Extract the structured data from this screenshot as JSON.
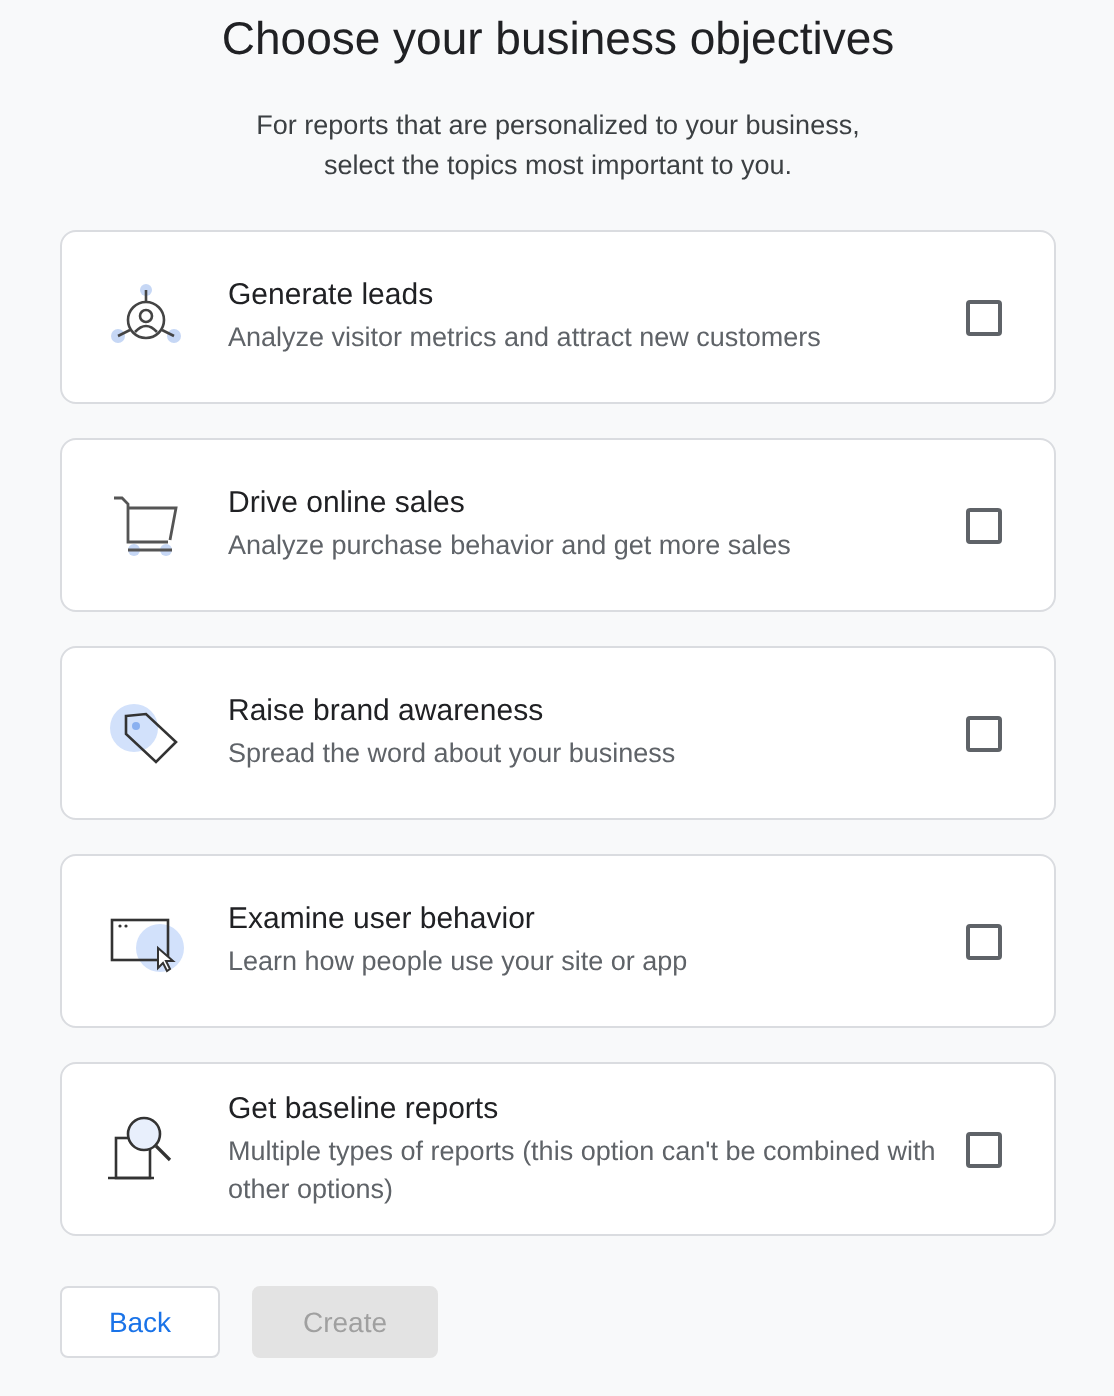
{
  "title": "Choose your business objectives",
  "subtitle_lines": [
    "For reports that are personalized to your business,",
    "select the topics most important to you."
  ],
  "objectives": [
    {
      "kind": "leads",
      "title": "Generate leads",
      "description": "Analyze visitor metrics and attract new customers",
      "checked": false
    },
    {
      "kind": "sales",
      "title": "Drive online sales",
      "description": "Analyze purchase behavior and get more sales",
      "checked": false
    },
    {
      "kind": "brand",
      "title": "Raise brand awareness",
      "description": "Spread the word about your business",
      "checked": false
    },
    {
      "kind": "behavior",
      "title": "Examine user behavior",
      "description": "Learn how people use your site or app",
      "checked": false
    },
    {
      "kind": "baseline",
      "title": "Get baseline reports",
      "description": "Multiple types of reports (this option can't be combined with other options)",
      "checked": false
    }
  ],
  "buttons": [
    {
      "label": "Back",
      "disabled": false
    },
    {
      "label": "Create",
      "disabled": true
    }
  ]
}
